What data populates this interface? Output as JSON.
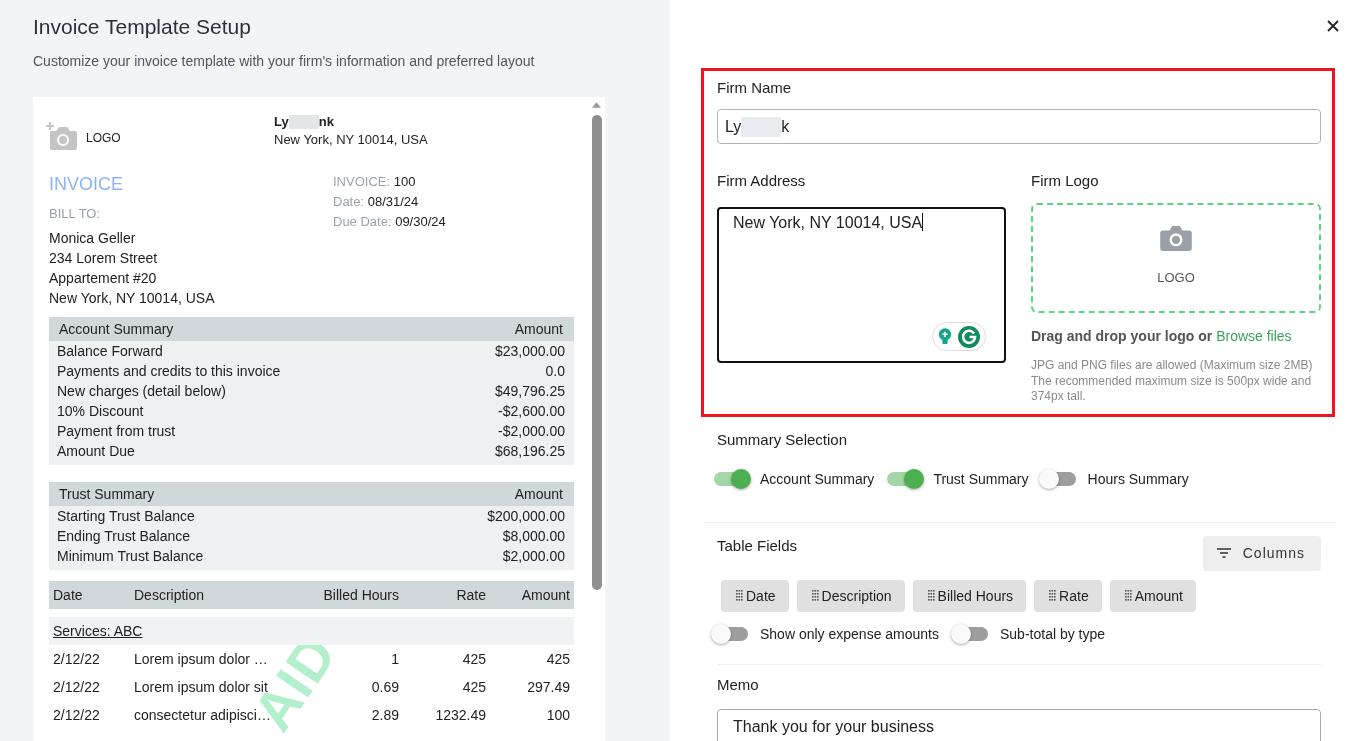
{
  "header": {
    "title": "Invoice Template Setup",
    "subtitle": "Customize your invoice template with your firm's information and preferred layout"
  },
  "invoice_preview": {
    "logo_label": "LOGO",
    "firm_name_parts": [
      "Ly",
      "nk"
    ],
    "firm_address": "New York, NY 10014, USA",
    "doc_title": "INVOICE",
    "bill_to_label": "BILL TO:",
    "bill_to_lines": [
      "Monica Geller",
      "234 Lorem Street",
      "Appartement #20",
      "New York, NY 10014, USA"
    ],
    "meta": [
      {
        "label": "INVOICE:",
        "value": "100"
      },
      {
        "label": "Date:",
        "value": "08/31/24"
      },
      {
        "label": "Due Date:",
        "value": "09/30/24"
      }
    ],
    "summaries": [
      {
        "title": "Account Summary",
        "amount_header": "Amount",
        "rows": [
          {
            "label": "Balance Forward",
            "amount": "$23,000.00"
          },
          {
            "label": "Payments and credits to this invoice",
            "amount": "0.0"
          },
          {
            "label": "New charges (detail below)",
            "amount": "$49,796.25"
          },
          {
            "label": "10% Discount",
            "amount": "-$2,600.00"
          },
          {
            "label": "Payment from trust",
            "amount": "-$2,000.00"
          },
          {
            "label": "Amount Due",
            "amount": "$68,196.25"
          }
        ]
      },
      {
        "title": "Trust Summary",
        "amount_header": "Amount",
        "rows": [
          {
            "label": "Starting Trust Balance",
            "amount": "$200,000.00"
          },
          {
            "label": "Ending Trust Balance",
            "amount": "$8,000.00"
          },
          {
            "label": "Minimum Trust Balance",
            "amount": "$2,000.00"
          }
        ]
      }
    ],
    "items_table": {
      "columns": [
        "Date",
        "Description",
        "Billed Hours",
        "Rate",
        "Amount"
      ],
      "groups": [
        {
          "title": "Services: ABC",
          "rows": [
            [
              "2/12/22",
              "Lorem ipsum dolor …",
              "1",
              "425",
              "425"
            ],
            [
              "2/12/22",
              "Lorem ipsum dolor sit",
              "0.69",
              "425",
              "297.49"
            ],
            [
              "2/12/22",
              "consectetur adipisci…",
              "2.89",
              "1232.49",
              "100"
            ]
          ]
        }
      ]
    },
    "stamp": "AID"
  },
  "firm_form": {
    "highlighted": true,
    "name_label": "Firm Name",
    "name_value_parts": [
      "Ly",
      "k"
    ],
    "address_label": "Firm Address",
    "address_value": "New York, NY 10014, USA",
    "address_focused": true,
    "logo_label": "Firm Logo",
    "drop_zone_text": "LOGO",
    "drag_text": "Drag and drop your logo or",
    "browse_link": "Browse files",
    "help_lines": [
      "JPG and PNG files are allowed (Maximum size 2MB)",
      "The recommended maximum size is 500px wide and 374px tall."
    ]
  },
  "summary_selection": {
    "label": "Summary Selection",
    "toggles": [
      {
        "label": "Account Summary",
        "on": true
      },
      {
        "label": "Trust Summary",
        "on": true
      },
      {
        "label": "Hours Summary",
        "on": false
      }
    ]
  },
  "table_fields": {
    "label": "Table Fields",
    "columns_button": "Columns",
    "fields": [
      "Date",
      "Description",
      "Billed Hours",
      "Rate",
      "Amount"
    ],
    "toggles": [
      {
        "label": "Show only expense amounts",
        "on": false
      },
      {
        "label": "Sub-total by type",
        "on": false
      }
    ]
  },
  "memo": {
    "label": "Memo",
    "value": "Thank you for your business"
  }
}
